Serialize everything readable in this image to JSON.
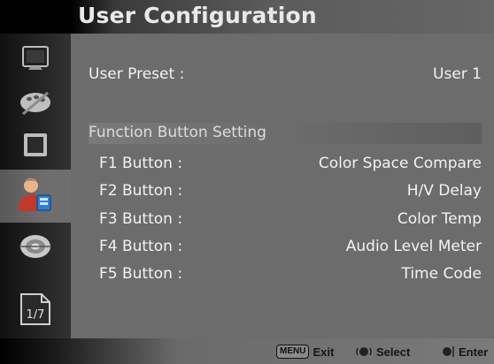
{
  "title": "User Configuration",
  "sidebar": {
    "items": [
      {
        "icon": "monitor-icon"
      },
      {
        "icon": "color-palette-icon"
      },
      {
        "icon": "screen-icon"
      },
      {
        "icon": "user-config-icon"
      },
      {
        "icon": "disc-icon"
      }
    ],
    "page_indicator": "1/7"
  },
  "main": {
    "user_preset": {
      "label": "User Preset :",
      "value": "User 1"
    },
    "section_title": "Function Button Setting",
    "buttons": [
      {
        "label": "F1 Button :",
        "value": "Color Space Compare"
      },
      {
        "label": "F2 Button :",
        "value": "H/V Delay"
      },
      {
        "label": "F3 Button :",
        "value": "Color Temp"
      },
      {
        "label": "F4 Button :",
        "value": "Audio Level Meter"
      },
      {
        "label": "F5 Button :",
        "value": "Time Code"
      }
    ]
  },
  "footer": {
    "menu_key": "MENU",
    "exit": "Exit",
    "select": "Select",
    "enter": "Enter"
  }
}
